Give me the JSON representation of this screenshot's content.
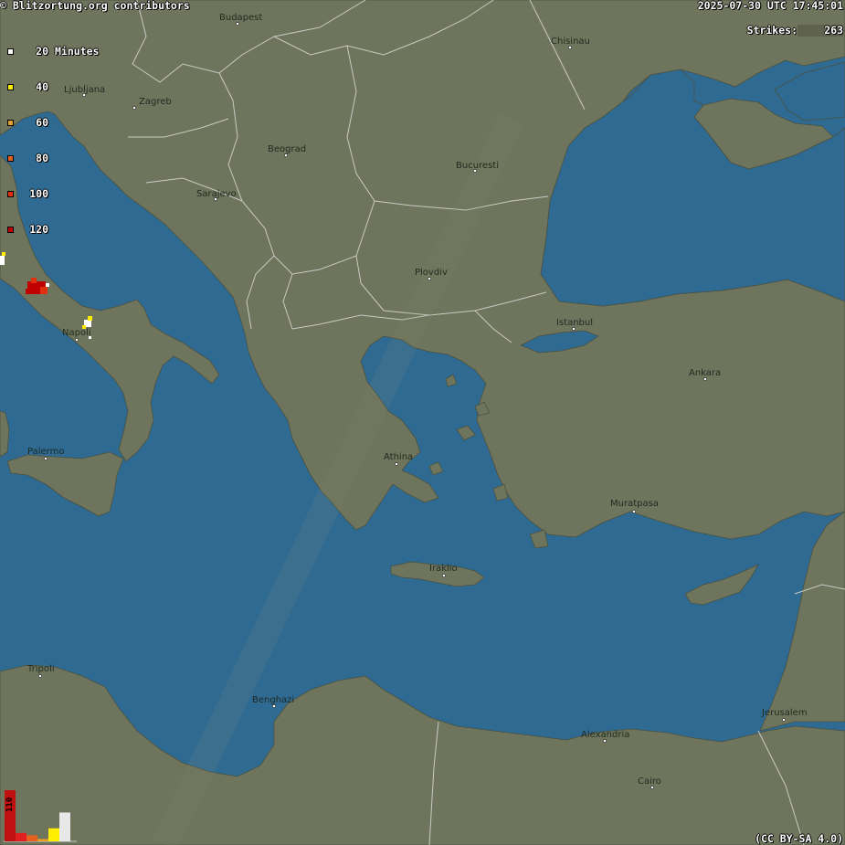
{
  "header": {
    "credit": "© Blitzortung.org contributors",
    "timestamp": "2025-07-30 UTC 17:45:01",
    "strikes_label": "Strikes:",
    "strikes_value": "263"
  },
  "legend": {
    "title": "Minutes",
    "items": [
      {
        "label": "20",
        "color": "#ffffff",
        "suffix": "Minutes"
      },
      {
        "label": "40",
        "color": "#ffee00"
      },
      {
        "label": "60",
        "color": "#e0a030"
      },
      {
        "label": "80",
        "color": "#e06020"
      },
      {
        "label": "100",
        "color": "#e03010"
      },
      {
        "label": "120",
        "color": "#c00000"
      }
    ]
  },
  "histogram": {
    "max_label": "110",
    "bars": [
      {
        "value": 110,
        "color": "#c01010"
      },
      {
        "value": 18,
        "color": "#e02020"
      },
      {
        "value": 13,
        "color": "#e86020"
      },
      {
        "value": 5,
        "color": "#e8a020"
      },
      {
        "value": 28,
        "color": "#ffee00"
      },
      {
        "value": 62,
        "color": "#e8e8e8"
      }
    ]
  },
  "cities": [
    {
      "name": "Budapest"
    },
    {
      "name": "Chisinau"
    },
    {
      "name": "Ljubljana"
    },
    {
      "name": "Zagreb"
    },
    {
      "name": "Beograd"
    },
    {
      "name": "Bucuresti"
    },
    {
      "name": "Sarajevo"
    },
    {
      "name": "Plovdiv"
    },
    {
      "name": "Istanbul"
    },
    {
      "name": "Ankara"
    },
    {
      "name": "Napoli"
    },
    {
      "name": "Palermo"
    },
    {
      "name": "Athina"
    },
    {
      "name": "Muratpasa"
    },
    {
      "name": "Iraklio"
    },
    {
      "name": "Tripoli"
    },
    {
      "name": "Benghazi"
    },
    {
      "name": "Alexandria"
    },
    {
      "name": "Jerusalem"
    },
    {
      "name": "Cairo"
    }
  ],
  "license": "(CC BY-SA 4.0)",
  "colors": {
    "sea": "#2f6a93",
    "land": "#6f745c",
    "border": "#c9cbc0"
  }
}
